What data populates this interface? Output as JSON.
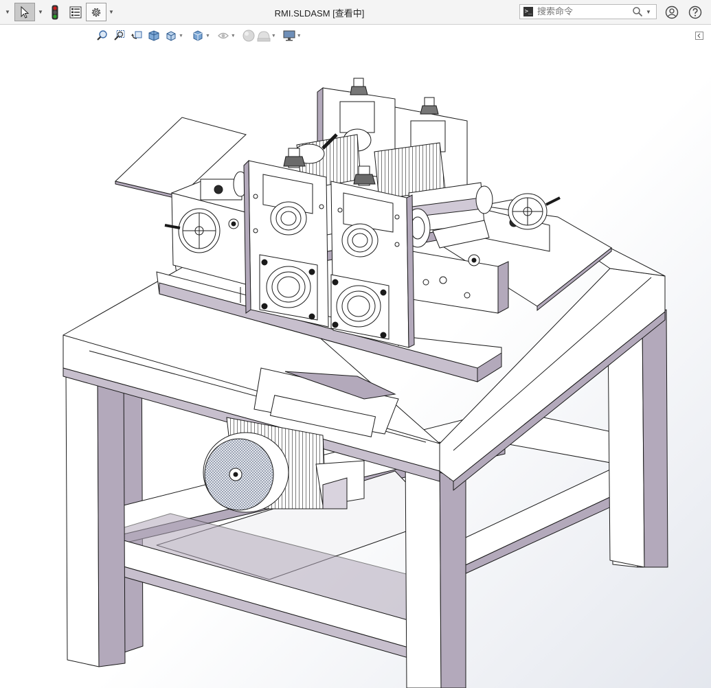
{
  "window": {
    "title": "RMI.SLDASM [查看中]"
  },
  "toolbar": {
    "items": [
      "select-arrow-icon",
      "traffic-light-icon",
      "property-manager-icon",
      "options-gear-icon"
    ]
  },
  "search": {
    "placeholder": "搜索命令"
  },
  "heads_up_toolbar": {
    "items": [
      "zoom-to-fit-icon",
      "zoom-to-area-icon",
      "previous-view-icon",
      "section-view-icon",
      "view-orientation-icon",
      "display-style-icon",
      "hide-show-items-icon",
      "edit-appearance-icon",
      "apply-scene-icon",
      "view-settings-icon"
    ]
  },
  "colors": {
    "frame_face": "#ffffff",
    "frame_side": "#b3a9bb",
    "frame_shadow": "#c7bfcd",
    "outline": "#1a1a1a",
    "accent_red": "#cc2020",
    "accent_green": "#2ca02c"
  }
}
